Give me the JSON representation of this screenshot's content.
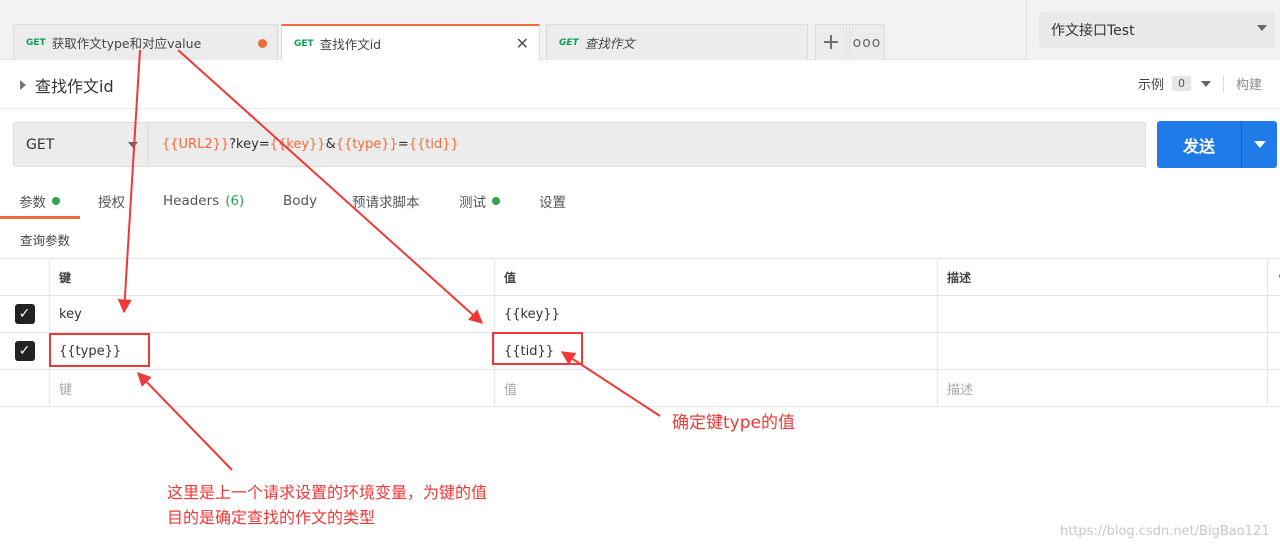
{
  "tabs": [
    {
      "method": "GET",
      "label": "获取作文type和对应value",
      "unsaved": true
    },
    {
      "method": "GET",
      "label": "查找作文id",
      "active": true
    },
    {
      "method": "GET",
      "label": "查找作文"
    }
  ],
  "tab_buttons": {
    "add_icon": "plus-icon",
    "more_icon": "more-icon"
  },
  "environment": {
    "selected": "作文接口Test"
  },
  "request": {
    "name": "查找作文id",
    "examples_label": "示例",
    "examples_count": "0",
    "build_label": "构建",
    "method": "GET",
    "url": {
      "var1": "{{URL2}}",
      "t1": "?key=",
      "var2": "{{key}}",
      "t2": "&",
      "var3": "{{type}}",
      "t3": "=",
      "var4": "{{tid}}"
    },
    "send_label": "发送"
  },
  "subtabs": [
    {
      "label": "参数",
      "dot": true,
      "active": true
    },
    {
      "label": "授权"
    },
    {
      "label": "Headers",
      "count": "(6)"
    },
    {
      "label": "Body"
    },
    {
      "label": "预请求脚本"
    },
    {
      "label": "测试",
      "dot": true
    },
    {
      "label": "设置"
    }
  ],
  "query_section_label": "查询参数",
  "params_table": {
    "headers": [
      "键",
      "值",
      "描述"
    ],
    "rows": [
      {
        "checked": true,
        "key": "key",
        "value": "{{key}}",
        "description": ""
      },
      {
        "checked": true,
        "key": "{{type}}",
        "value": "{{tid}}",
        "description": ""
      }
    ],
    "placeholders": {
      "key": "键",
      "value": "值",
      "description": "描述"
    }
  },
  "annotations": {
    "note1": "确定键type的值",
    "note2_line1": "这里是上一个请求设置的环境变量，为键的值",
    "note2_line2": "目的是确定查找的作文的类型"
  },
  "colors": {
    "accent": "#f26b3a",
    "send": "#1e7be8",
    "annotation": "#f03838",
    "status_dot": "#2ea44f"
  },
  "watermark": "https://blog.csdn.net/BigBao121"
}
